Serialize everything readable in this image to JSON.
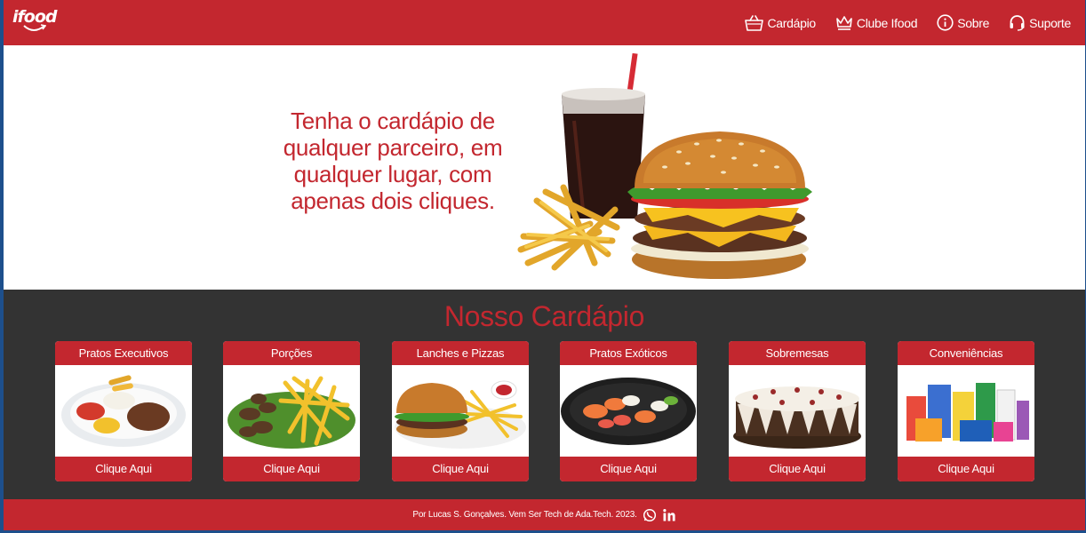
{
  "header": {
    "logo_text": "ifood",
    "nav": [
      {
        "label": "Cardápio",
        "icon": "basket-icon"
      },
      {
        "label": "Clube Ifood",
        "icon": "crown-icon"
      },
      {
        "label": "Sobre",
        "icon": "info-icon"
      },
      {
        "label": "Suporte",
        "icon": "headset-icon"
      }
    ]
  },
  "hero": {
    "headline": "Tenha o cardápio de qualquer parceiro, em qualquer lugar, com apenas dois cliques."
  },
  "menu": {
    "title": "Nosso Cardápio",
    "cards": [
      {
        "title": "Pratos Executivos",
        "cta": "Clique Aqui"
      },
      {
        "title": "Porções",
        "cta": "Clique Aqui"
      },
      {
        "title": "Lanches e Pizzas",
        "cta": "Clique Aqui"
      },
      {
        "title": "Pratos Exóticos",
        "cta": "Clique Aqui"
      },
      {
        "title": "Sobremesas",
        "cta": "Clique Aqui"
      },
      {
        "title": "Conveniências",
        "cta": "Clique Aqui"
      }
    ]
  },
  "footer": {
    "text": "Por Lucas S. Gonçalves. Vem Ser Tech de Ada.Tech. 2023.",
    "icons": [
      "whatsapp-icon",
      "linkedin-icon"
    ]
  },
  "colors": {
    "brand_red": "#c3272f",
    "dark_section": "#333333",
    "white": "#ffffff"
  }
}
